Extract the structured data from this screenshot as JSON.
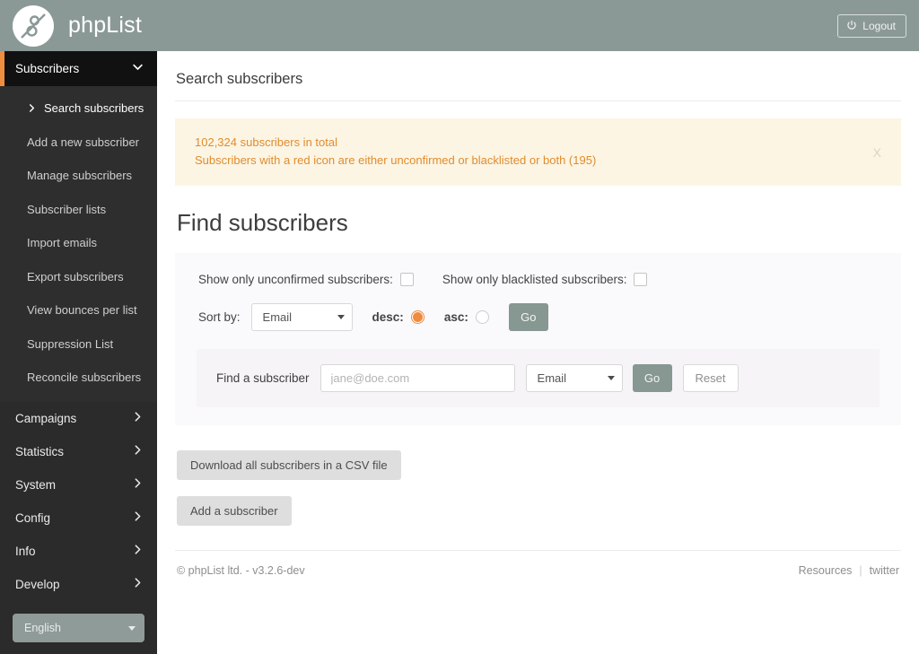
{
  "header": {
    "brand": "phpList",
    "logo_icon": "phplist-logo-icon",
    "logout_label": "Logout",
    "logout_icon": "power-icon",
    "bg_color": "#8b9996"
  },
  "sidebar": {
    "bg_color": "#2b2b2b",
    "accent_color": "#ef8e3f",
    "open_group": {
      "label": "Subscribers",
      "icon": "chevron-down-icon"
    },
    "subitems": [
      {
        "label": "Search subscribers",
        "active": true,
        "icon": "chevron-right-icon"
      },
      {
        "label": "Add a new subscriber",
        "active": false
      },
      {
        "label": "Manage subscribers",
        "active": false
      },
      {
        "label": "Subscriber lists",
        "active": false
      },
      {
        "label": "Import emails",
        "active": false
      },
      {
        "label": "Export subscribers",
        "active": false
      },
      {
        "label": "View bounces per list",
        "active": false
      },
      {
        "label": "Suppression List",
        "active": false
      },
      {
        "label": "Reconcile subscribers",
        "active": false
      }
    ],
    "groups": [
      {
        "label": "Campaigns",
        "icon": "chevron-right-icon"
      },
      {
        "label": "Statistics",
        "icon": "chevron-right-icon"
      },
      {
        "label": "System",
        "icon": "chevron-right-icon"
      },
      {
        "label": "Config",
        "icon": "chevron-right-icon"
      },
      {
        "label": "Info",
        "icon": "chevron-right-icon"
      },
      {
        "label": "Develop",
        "icon": "chevron-right-icon"
      }
    ],
    "language": {
      "selected": "English",
      "icon": "caret-down-icon"
    }
  },
  "main": {
    "page_title": "Search subscribers",
    "alert": {
      "line1": "102,324 subscribers in total",
      "line2": "Subscribers with a red icon are either unconfirmed or blacklisted or both (195)",
      "close_label": "X",
      "bg_color": "#fcf5e4",
      "text_color": "#e08c2e"
    },
    "section_title": "Find subscribers",
    "filters": {
      "unconfirmed_label": "Show only unconfirmed subscribers:",
      "unconfirmed_checked": false,
      "blacklisted_label": "Show only blacklisted subscribers:",
      "blacklisted_checked": false,
      "sort_by_label": "Sort by:",
      "sort_by_value": "Email",
      "desc_label": "desc:",
      "desc_selected": true,
      "asc_label": "asc:",
      "asc_selected": false,
      "go_label": "Go"
    },
    "find": {
      "label": "Find a subscriber",
      "input_value": "",
      "input_placeholder": "jane@doe.com",
      "field_value": "Email",
      "go_label": "Go",
      "reset_label": "Reset"
    },
    "actions": {
      "download_csv_label": "Download all subscribers in a CSV file",
      "add_subscriber_label": "Add a subscriber"
    }
  },
  "footer": {
    "copyright": "© phpList ltd. - v3.2.6-dev",
    "resources_label": "Resources",
    "separator": "|",
    "twitter_label": "twitter"
  }
}
